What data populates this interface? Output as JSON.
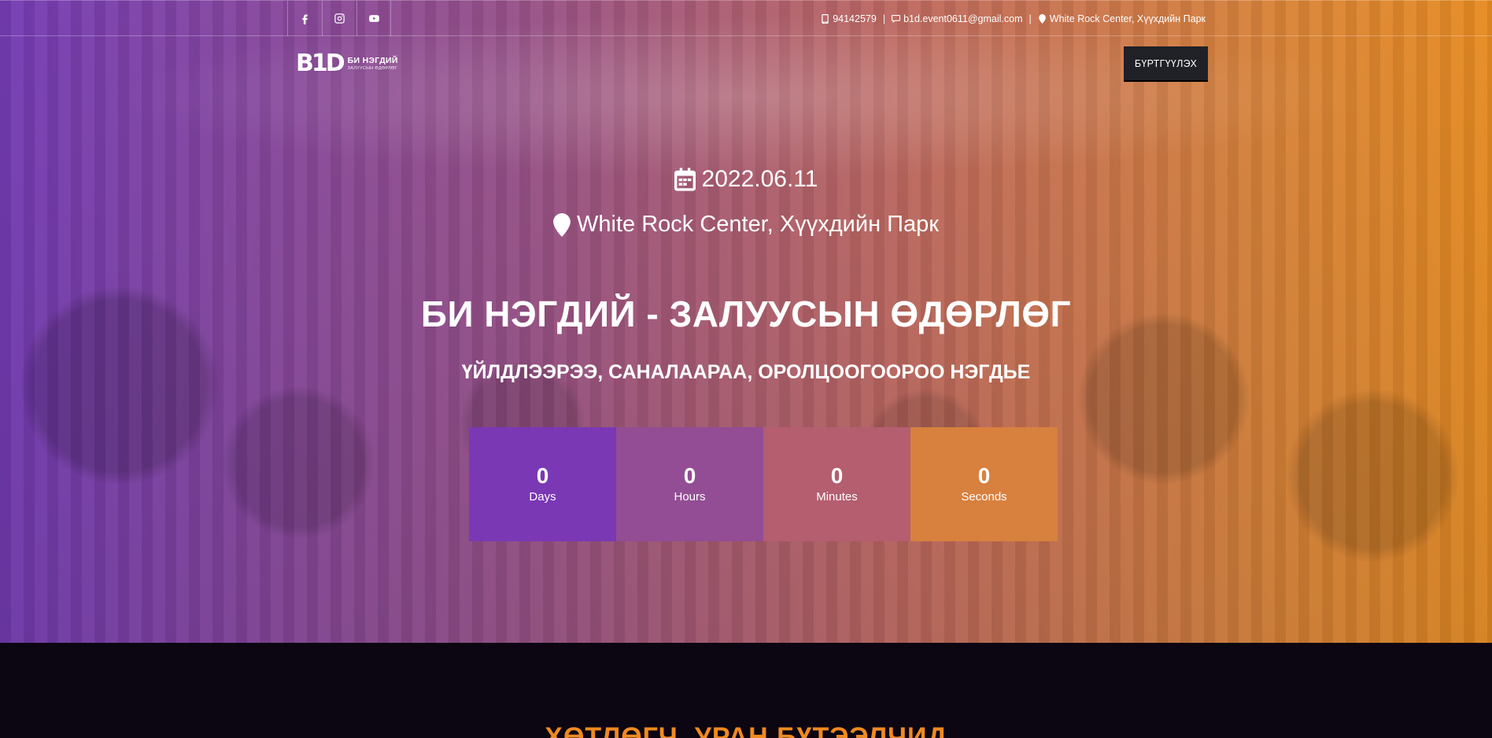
{
  "topbar": {
    "social": [
      {
        "name": "facebook-icon"
      },
      {
        "name": "instagram-icon"
      },
      {
        "name": "youtube-icon"
      }
    ],
    "phone": "94142579",
    "email": "b1d.event0611@gmail.com",
    "address": "White Rock Center, Хүүхдийн Парк",
    "separator": "|"
  },
  "nav": {
    "logo_mark": "B1D",
    "logo_line1": "БИ НЭГДИЙ",
    "logo_line2": "ЗАЛУУСЫН ӨДӨРЛӨГ",
    "register_label": "БҮРТГҮҮЛЭХ"
  },
  "hero": {
    "date": "2022.06.11",
    "location": "White Rock Center, Хүүхдийн Парк",
    "title": "БИ НЭГДИЙ - ЗАЛУУСЫН ӨДӨРЛӨГ",
    "subtitle": "ҮЙЛДЛЭЭРЭЭ, САНАЛААРАА, ОРОЛЦООГООРОО НЭГДЬЕ",
    "countdown": {
      "days": {
        "value": "0",
        "label": "Days"
      },
      "hours": {
        "value": "0",
        "label": "Hours"
      },
      "minutes": {
        "value": "0",
        "label": "Minutes"
      },
      "seconds": {
        "value": "0",
        "label": "Seconds"
      }
    }
  },
  "next_section": {
    "title": "ХӨТЛӨГЧ, УРАН БҮТЭЭЛЧИД"
  },
  "colors": {
    "gradient_start": "#7b3fbe",
    "gradient_end": "#f39324",
    "register_bg": "#1f2126",
    "next_title": "#f08a1f"
  }
}
